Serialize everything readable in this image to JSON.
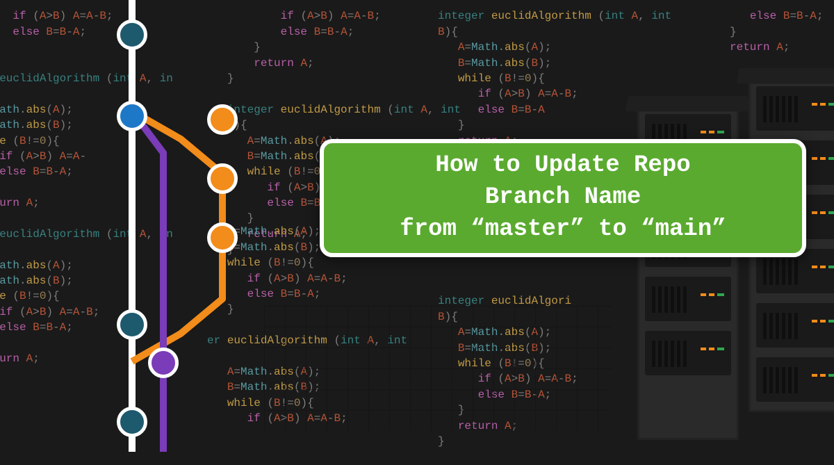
{
  "title": {
    "line1": "How to Update Repo",
    "line2": "Branch Name",
    "line3": "from “master” to “main”"
  },
  "code_snippet_tokens": {
    "func_sig": "integer euclidAlgorithm (int A, int B){",
    "l1": "A=Math.abs(A);",
    "l2": "B=Math.abs(B);",
    "l3": "while (B!=0){",
    "l4": "if (A>B) A=A-B;",
    "l5": "else B=B-A;",
    "l6": "}",
    "l7": "return A;",
    "l8": "}"
  },
  "colors": {
    "card_bg": "#5aaa2f",
    "card_border": "#ffffff",
    "commit_teal": "#1e5a6e",
    "commit_blue": "#1e78c8",
    "commit_orange": "#f28c1a",
    "commit_purple": "#7a3cb8",
    "bg": "#1a1a1a"
  }
}
